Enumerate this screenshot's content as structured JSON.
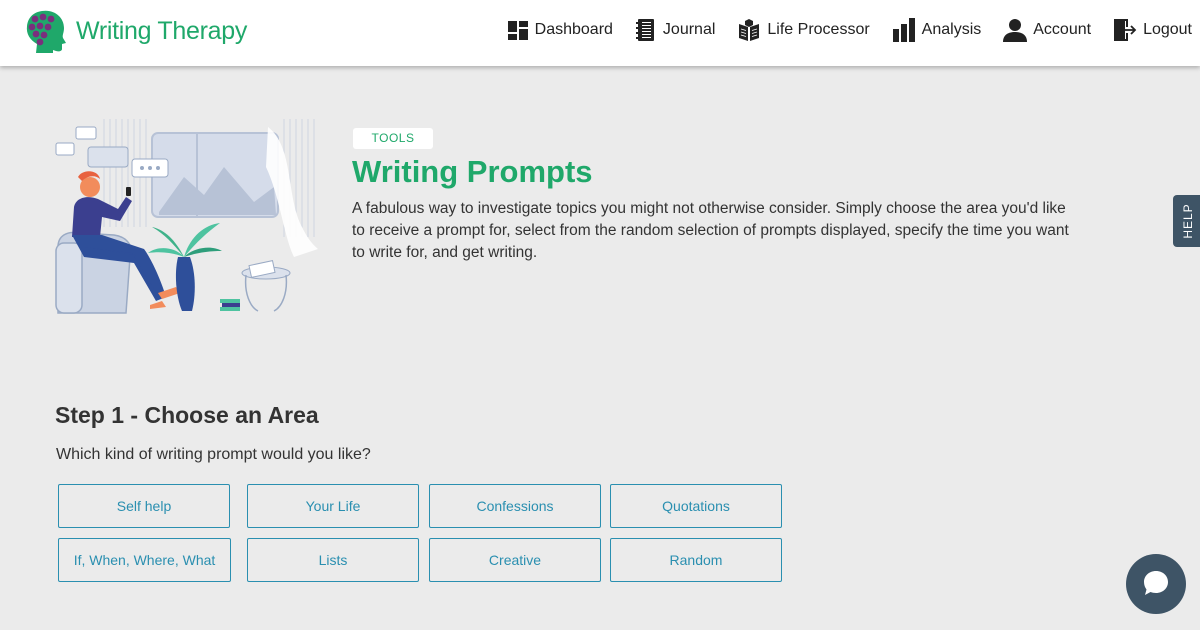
{
  "brand": {
    "name": "Writing Therapy",
    "color": "#1fa86a"
  },
  "nav": [
    {
      "label": "Dashboard",
      "icon": "dashboard-icon"
    },
    {
      "label": "Journal",
      "icon": "journal-icon"
    },
    {
      "label": "Life Processor",
      "icon": "book-icon"
    },
    {
      "label": "Analysis",
      "icon": "bar-chart-icon"
    },
    {
      "label": "Account",
      "icon": "user-icon"
    },
    {
      "label": "Logout",
      "icon": "logout-icon"
    }
  ],
  "hero": {
    "tag": "TOOLS",
    "title": "Writing Prompts",
    "description": "A fabulous way to investigate topics you might not otherwise consider. Simply choose the area you'd like to receive a prompt for, select from the random selection of prompts displayed, specify the time you want to write for, and get writing."
  },
  "help": {
    "label": "HELP"
  },
  "step1": {
    "title": "Step 1 - Choose an Area",
    "question": "Which kind of writing prompt would you like?",
    "areas": [
      "Self help",
      "Your Life",
      "Confessions",
      "Quotations",
      "If, When, Where, What",
      "Lists",
      "Creative",
      "Random"
    ]
  },
  "colors": {
    "accent": "#1fa86a",
    "button": "#2a8fb0",
    "dark": "#3e5466",
    "background": "#ebebeb"
  }
}
